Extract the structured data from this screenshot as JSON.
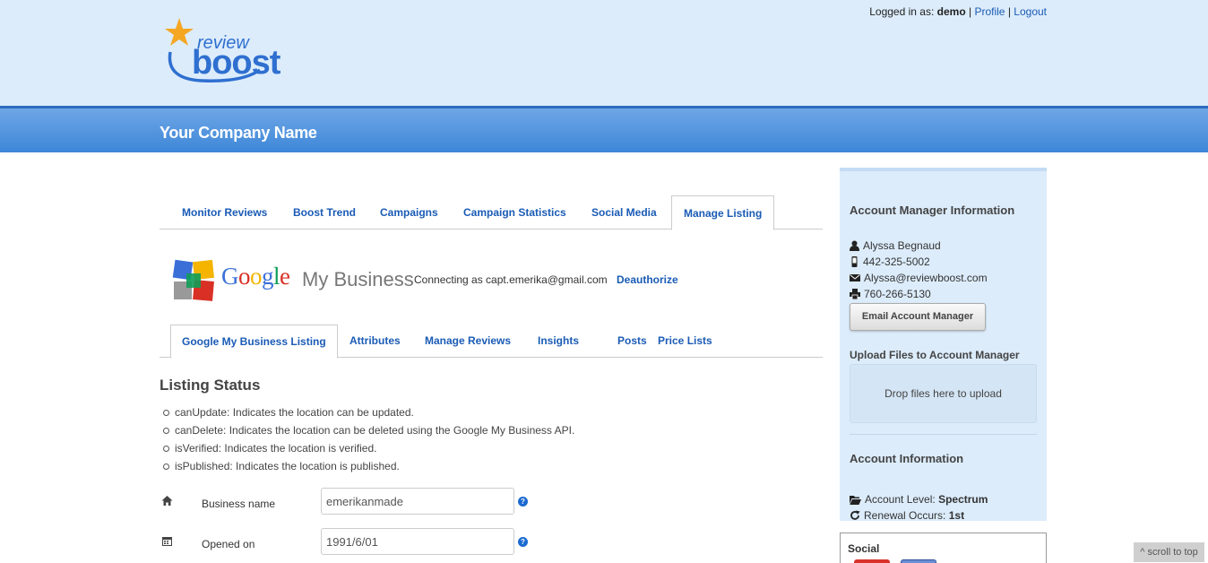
{
  "header": {
    "logo_text_top": "review",
    "logo_text_bottom": "boost",
    "login_prefix": "Logged in as:",
    "username": "demo",
    "separator": "|",
    "profile_link": "Profile",
    "logout_link": "Logout",
    "company_name": "Your Company Name"
  },
  "main_tabs": [
    {
      "label": "Monitor Reviews"
    },
    {
      "label": "Boost Trend"
    },
    {
      "label": "Campaigns"
    },
    {
      "label": "Campaign Statistics"
    },
    {
      "label": "Social Media"
    },
    {
      "label": "Manage Listing",
      "active": true
    }
  ],
  "gmb": {
    "google_letters": [
      "G",
      "o",
      "o",
      "g",
      "l",
      "e"
    ],
    "google_colors": [
      "#3a6fd8",
      "#d93025",
      "#f4b400",
      "#3a6fd8",
      "#0f9d58",
      "#d93025"
    ],
    "my_business": "My Business",
    "connecting_text": "Connecting as capt.emerika@gmail.com",
    "deauthorize": "Deauthorize"
  },
  "sub_tabs": [
    {
      "label": "Google My Business Listing",
      "active": true
    },
    {
      "label": "Attributes"
    },
    {
      "label": "Manage Reviews"
    },
    {
      "label": "Insights"
    },
    {
      "label": "Posts"
    },
    {
      "label": "Price Lists"
    }
  ],
  "listing_status": {
    "title": "Listing Status",
    "items": [
      "canUpdate: Indicates the location can be updated.",
      "canDelete: Indicates the location can be deleted using the Google My Business API.",
      "isVerified: Indicates the location is verified.",
      "isPublished: Indicates the location is published."
    ]
  },
  "fields": {
    "business_name": {
      "label": "Business name",
      "value": "emerikanmade",
      "icon": "home-icon"
    },
    "opened_on": {
      "label": "Opened on",
      "value": "1991/6/01",
      "icon": "calendar-icon"
    },
    "help_glyph": "?"
  },
  "sidebar": {
    "manager_title": "Account Manager Information",
    "manager_name": "Alyssa Begnaud",
    "manager_phone": "442-325-5002",
    "manager_email": "Alyssa@reviewboost.com",
    "manager_fax": "760-266-5130",
    "email_button": "Email Account Manager",
    "upload_title": "Upload Files to Account Manager",
    "dropzone_text": "Drop files here to upload",
    "account_title": "Account Information",
    "account_level_label": "Account Level:",
    "account_level_value": "Spectrum",
    "renewal_label": "Renewal Occurs:",
    "renewal_value": "1st"
  },
  "social": {
    "title": "Social"
  },
  "scroll_top": "^ scroll to top",
  "colors": {
    "header_bg": "#dcecfb",
    "bluebar": "#4a8fdc",
    "link": "#1a5bb5",
    "sidebar_bg": "#dcecfb"
  }
}
